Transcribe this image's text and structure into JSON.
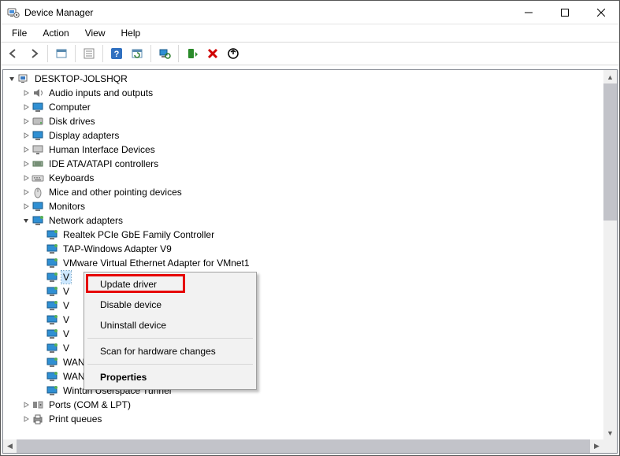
{
  "window": {
    "title": "Device Manager"
  },
  "menu": {
    "items": [
      "File",
      "Action",
      "View",
      "Help"
    ]
  },
  "toolbar": {
    "back": "Back",
    "forward": "Forward",
    "show_hidden": "Show hidden devices",
    "properties": "Properties",
    "help": "Help",
    "refresh": "Refresh",
    "scan": "Scan for hardware changes",
    "update_driver": "Update driver",
    "uninstall": "Uninstall device",
    "disable": "Disable device"
  },
  "tree": {
    "root": "DESKTOP-JOLSHQR",
    "categories": [
      {
        "label": "Audio inputs and outputs",
        "icon": "audio"
      },
      {
        "label": "Computer",
        "icon": "monitor"
      },
      {
        "label": "Disk drives",
        "icon": "disk"
      },
      {
        "label": "Display adapters",
        "icon": "monitor"
      },
      {
        "label": "Human Interface Devices",
        "icon": "hid"
      },
      {
        "label": "IDE ATA/ATAPI controllers",
        "icon": "ide"
      },
      {
        "label": "Keyboards",
        "icon": "keyboard"
      },
      {
        "label": "Mice and other pointing devices",
        "icon": "mouse"
      },
      {
        "label": "Monitors",
        "icon": "monitor"
      },
      {
        "label": "Network adapters",
        "icon": "network",
        "expanded": true,
        "children": [
          "Realtek PCIe GbE Family Controller",
          "TAP-Windows Adapter V9",
          "VMware Virtual Ethernet Adapter for VMnet1",
          "V",
          "V",
          "V",
          "V",
          "V",
          "V",
          "WAN Miniport (PPTP)",
          "WAN Miniport (SSTP)",
          "Wintun Userspace Tunnel"
        ],
        "selected_index": 3
      },
      {
        "label": "Ports (COM & LPT)",
        "icon": "ports"
      },
      {
        "label": "Print queues",
        "icon": "printer"
      }
    ]
  },
  "context_menu": {
    "items": [
      {
        "label": "Update driver",
        "highlighted": true
      },
      {
        "label": "Disable device"
      },
      {
        "label": "Uninstall device"
      },
      {
        "sep": true
      },
      {
        "label": "Scan for hardware changes"
      },
      {
        "sep": true
      },
      {
        "label": "Properties",
        "bold": true
      }
    ]
  }
}
